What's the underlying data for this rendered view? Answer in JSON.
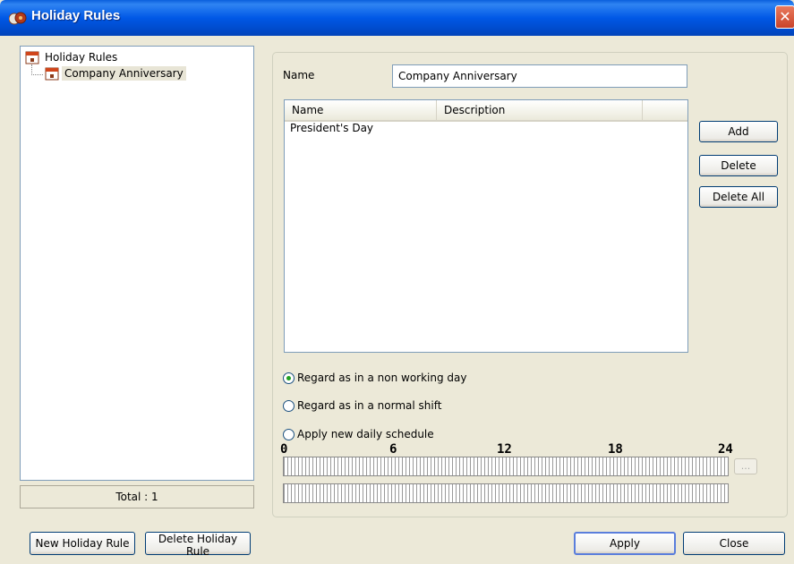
{
  "window": {
    "title": "Holiday Rules",
    "close_glyph": "✕"
  },
  "tree": {
    "root_label": "Holiday Rules",
    "items": [
      {
        "label": "Company Anniversary",
        "selected": true
      }
    ]
  },
  "total": {
    "text": "Total : 1"
  },
  "form": {
    "name_label": "Name",
    "name_value": "Company Anniversary"
  },
  "list": {
    "columns": [
      "Name",
      "Description"
    ],
    "rows": [
      {
        "name": "President's Day",
        "description": ""
      }
    ]
  },
  "side_buttons": {
    "add": "Add",
    "delete": "Delete",
    "delete_all": "Delete All"
  },
  "options": {
    "non_working": "Regard as in a non working day",
    "normal_shift": "Regard as in a normal shift",
    "new_schedule": "Apply new daily schedule",
    "selected": "non_working"
  },
  "schedule": {
    "ticks": [
      "0",
      "6",
      "12",
      "18",
      "24"
    ],
    "ellipsis": "..."
  },
  "bottom_buttons": {
    "new_rule": "New Holiday Rule",
    "delete_rule": "Delete Holiday Rule",
    "apply": "Apply",
    "close": "Close"
  },
  "colors": {
    "titlebar": "#0058e6",
    "close": "#c9432a",
    "radio_dot": "#21a121"
  },
  "icons": {
    "title": "holiday-app-icon",
    "tree": "calendar-icon",
    "close": "close-icon"
  }
}
